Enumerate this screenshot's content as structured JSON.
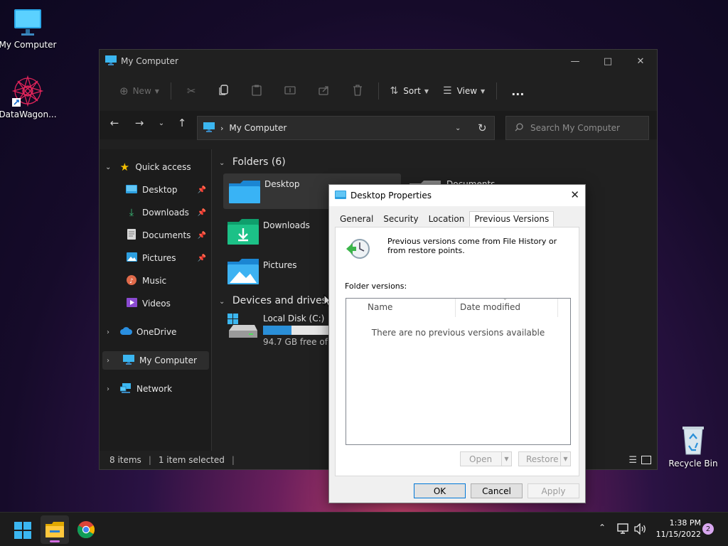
{
  "desktop": {
    "icons": [
      {
        "label": "My Computer"
      },
      {
        "label": "DataWagon..."
      },
      {
        "label": "Recycle Bin"
      }
    ]
  },
  "explorer": {
    "title": "My Computer",
    "toolbar": {
      "new_label": "New",
      "sort_label": "Sort",
      "view_label": "View",
      "more_label": "..."
    },
    "address": {
      "path": "My Computer",
      "search_placeholder": "Search My Computer"
    },
    "nav": {
      "quick_access": "Quick access",
      "items": [
        {
          "label": "Desktop"
        },
        {
          "label": "Downloads"
        },
        {
          "label": "Documents"
        },
        {
          "label": "Pictures"
        },
        {
          "label": "Music"
        },
        {
          "label": "Videos"
        }
      ],
      "onedrive": "OneDrive",
      "my_computer": "My Computer",
      "network": "Network"
    },
    "content": {
      "folders_header": "Folders (6)",
      "folders": [
        {
          "label": "Desktop"
        },
        {
          "label": "Downloads"
        },
        {
          "label": "Pictures"
        },
        {
          "label": "Documents"
        }
      ],
      "devices_header": "Devices and drives (",
      "drive": {
        "name": "Local Disk (C:)",
        "free": "94.7 GB free of 11",
        "used_fraction": 0.43
      }
    },
    "status": {
      "items": "8 items",
      "selected": "1 item selected"
    }
  },
  "dialog": {
    "title": "Desktop Properties",
    "tabs": [
      {
        "label": "General"
      },
      {
        "label": "Security"
      },
      {
        "label": "Location"
      },
      {
        "label": "Previous Versions"
      }
    ],
    "info": "Previous versions come from File History or from restore points.",
    "folder_versions_label": "Folder versions:",
    "columns": [
      "Name",
      "Date modified"
    ],
    "empty_text": "There are no previous versions available",
    "open_label": "Open",
    "restore_label": "Restore",
    "ok_label": "OK",
    "cancel_label": "Cancel",
    "apply_label": "Apply"
  },
  "taskbar": {
    "time": "1:38 PM",
    "date": "11/15/2022",
    "notification_count": "2"
  }
}
